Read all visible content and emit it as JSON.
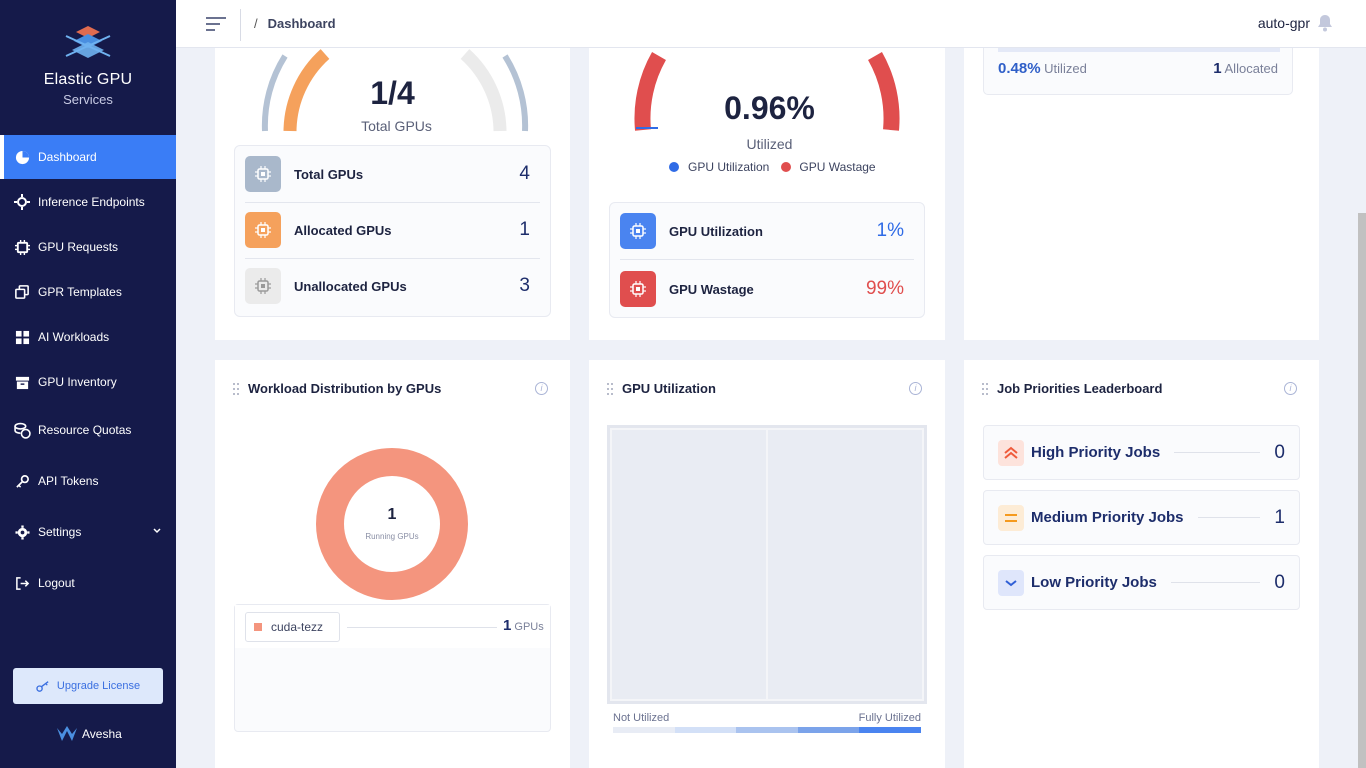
{
  "sidebar": {
    "brand_title": "Elastic GPU",
    "brand_subtitle": "Services",
    "items": [
      {
        "label": "Dashboard",
        "icon": "pie-chart-icon"
      },
      {
        "label": "Inference Endpoints",
        "icon": "gear-chip-icon"
      },
      {
        "label": "GPU Requests",
        "icon": "chip-icon"
      },
      {
        "label": "GPR Templates",
        "icon": "copy-icon"
      },
      {
        "label": "AI Workloads",
        "icon": "grid-icon"
      },
      {
        "label": "GPU Inventory",
        "icon": "archive-icon"
      },
      {
        "label": "Resource Quotas",
        "icon": "coins-icon"
      },
      {
        "label": "API Tokens",
        "icon": "key-icon"
      },
      {
        "label": "Settings",
        "icon": "cog-icon"
      },
      {
        "label": "Logout",
        "icon": "logout-icon"
      }
    ],
    "upgrade_label": "Upgrade License",
    "footer_brand": "Avesha"
  },
  "topbar": {
    "breadcrumb_sep": "/",
    "breadcrumb": "Dashboard",
    "user": "auto-gpr"
  },
  "gpu_summary": {
    "gauge_value": "1/4",
    "gauge_label": "Total GPUs",
    "rows": [
      {
        "label": "Total GPUs",
        "value": "4"
      },
      {
        "label": "Allocated GPUs",
        "value": "1"
      },
      {
        "label": "Unallocated GPUs",
        "value": "3"
      }
    ]
  },
  "utilization_gauge": {
    "value": "0.96%",
    "label": "Utilized",
    "legend": [
      "GPU Utilization",
      "GPU Wastage"
    ],
    "rows": [
      {
        "label": "GPU Utilization",
        "value": "1%"
      },
      {
        "label": "GPU Wastage",
        "value": "99%"
      }
    ],
    "colors": {
      "utilization": "#2f6be6",
      "wastage": "#e04e4e"
    }
  },
  "alloc_card": {
    "utilized_value": "0.48%",
    "utilized_label": "Utilized",
    "allocated_value": "1",
    "allocated_label": "Allocated"
  },
  "workload": {
    "title": "Workload Distribution by GPUs",
    "center_value": "1",
    "center_label": "Running GPUs",
    "legend_name": "cuda-tezz",
    "legend_value": "1",
    "legend_unit": "GPUs",
    "color": "#f4957e"
  },
  "gpu_util": {
    "title": "GPU Utilization",
    "scale_low": "Not Utilized",
    "scale_high": "Fully Utilized"
  },
  "priorities": {
    "title": "Job Priorities Leaderboard",
    "rows": [
      {
        "label": "High Priority Jobs",
        "value": "0",
        "icon": "double-chevron-up-icon"
      },
      {
        "label": "Medium Priority Jobs",
        "value": "1",
        "icon": "equals-icon"
      },
      {
        "label": "Low Priority Jobs",
        "value": "0",
        "icon": "chevron-down-icon"
      }
    ]
  }
}
